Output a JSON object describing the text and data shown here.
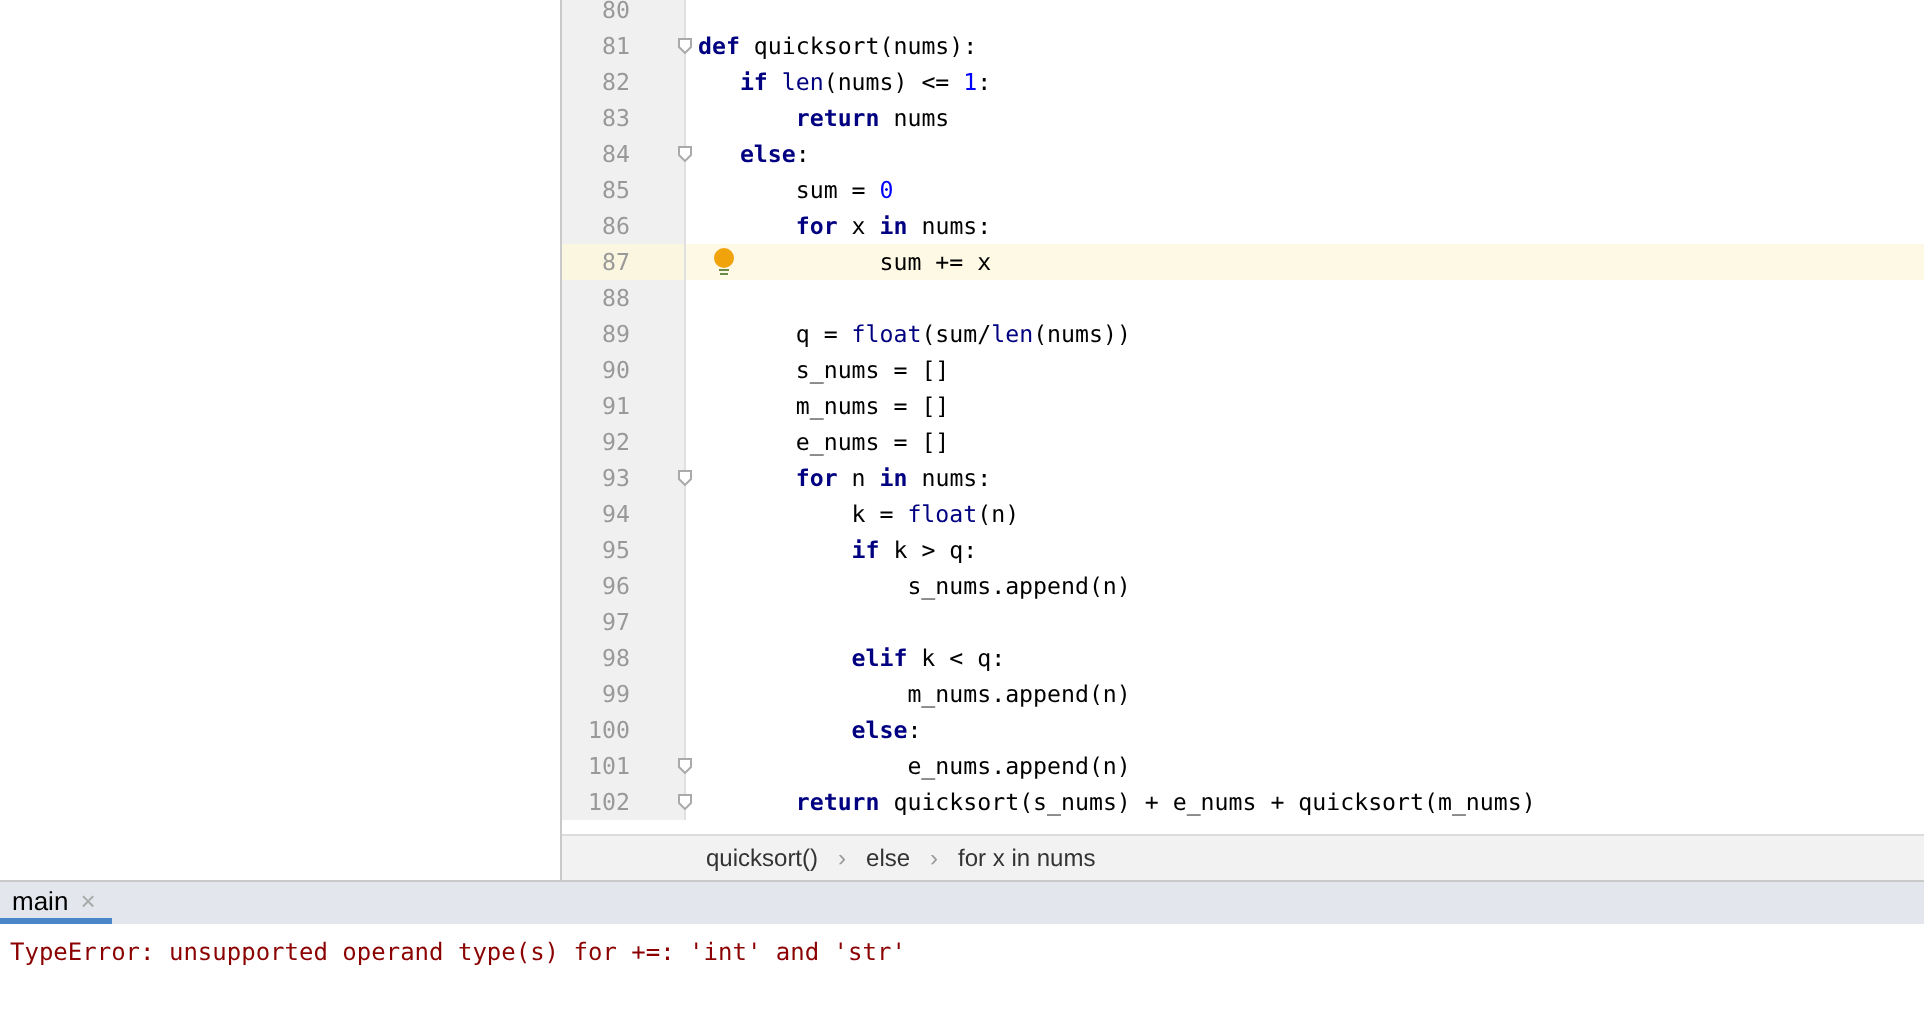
{
  "editor": {
    "lines": [
      {
        "number": "80"
      },
      {
        "number": "81",
        "tokens": [
          {
            "text": "def",
            "kind": "keyword"
          },
          {
            "text": " quicksort(nums):",
            "kind": "plain"
          }
        ],
        "fold": true
      },
      {
        "number": "82",
        "tokens": [
          {
            "text": "   if",
            "kind": "keyword"
          },
          {
            "text": " len",
            "kind": "builtin"
          },
          {
            "text": "(nums) <= ",
            "kind": "plain"
          },
          {
            "text": "1",
            "kind": "number"
          },
          {
            "text": ":",
            "kind": "plain"
          }
        ]
      },
      {
        "number": "83",
        "tokens": [
          {
            "text": "       return",
            "kind": "keyword"
          },
          {
            "text": " nums",
            "kind": "plain"
          }
        ]
      },
      {
        "number": "84",
        "tokens": [
          {
            "text": "   else",
            "kind": "keyword"
          },
          {
            "text": ":",
            "kind": "plain"
          }
        ],
        "fold": true
      },
      {
        "number": "85",
        "tokens": [
          {
            "text": "       sum = ",
            "kind": "plain"
          },
          {
            "text": "0",
            "kind": "number"
          }
        ]
      },
      {
        "number": "86",
        "tokens": [
          {
            "text": "       for",
            "kind": "keyword"
          },
          {
            "text": " x ",
            "kind": "plain"
          },
          {
            "text": "in",
            "kind": "keyword"
          },
          {
            "text": " nums:",
            "kind": "plain"
          }
        ]
      },
      {
        "number": "87",
        "tokens": [
          {
            "text": "             sum += x",
            "kind": "plain"
          }
        ],
        "highlighted": true,
        "bulb": true
      },
      {
        "number": "88"
      },
      {
        "number": "89",
        "tokens": [
          {
            "text": "       q = ",
            "kind": "plain"
          },
          {
            "text": "float",
            "kind": "builtin"
          },
          {
            "text": "(sum/",
            "kind": "plain"
          },
          {
            "text": "len",
            "kind": "builtin"
          },
          {
            "text": "(nums))",
            "kind": "plain"
          }
        ]
      },
      {
        "number": "90",
        "tokens": [
          {
            "text": "       s_nums = []",
            "kind": "plain"
          }
        ]
      },
      {
        "number": "91",
        "tokens": [
          {
            "text": "       m_nums = []",
            "kind": "plain"
          }
        ]
      },
      {
        "number": "92",
        "tokens": [
          {
            "text": "       e_nums = []",
            "kind": "plain"
          }
        ]
      },
      {
        "number": "93",
        "tokens": [
          {
            "text": "       for",
            "kind": "keyword"
          },
          {
            "text": " n ",
            "kind": "plain"
          },
          {
            "text": "in",
            "kind": "keyword"
          },
          {
            "text": " nums:",
            "kind": "plain"
          }
        ],
        "fold": true
      },
      {
        "number": "94",
        "tokens": [
          {
            "text": "           k = ",
            "kind": "plain"
          },
          {
            "text": "float",
            "kind": "builtin"
          },
          {
            "text": "(n)",
            "kind": "plain"
          }
        ]
      },
      {
        "number": "95",
        "tokens": [
          {
            "text": "           if",
            "kind": "keyword"
          },
          {
            "text": " k > q:",
            "kind": "plain"
          }
        ]
      },
      {
        "number": "96",
        "tokens": [
          {
            "text": "               s_nums.append(n)",
            "kind": "plain"
          }
        ]
      },
      {
        "number": "97"
      },
      {
        "number": "98",
        "tokens": [
          {
            "text": "           elif",
            "kind": "keyword"
          },
          {
            "text": " k < q:",
            "kind": "plain"
          }
        ]
      },
      {
        "number": "99",
        "tokens": [
          {
            "text": "               m_nums.append(n)",
            "kind": "plain"
          }
        ]
      },
      {
        "number": "100",
        "tokens": [
          {
            "text": "           else",
            "kind": "keyword"
          },
          {
            "text": ":",
            "kind": "plain"
          }
        ]
      },
      {
        "number": "101",
        "tokens": [
          {
            "text": "               e_nums.append(n)",
            "kind": "plain"
          }
        ],
        "fold": true
      },
      {
        "number": "102",
        "tokens": [
          {
            "text": "       return",
            "kind": "keyword"
          },
          {
            "text": " quicksort(s_nums) + e_nums + quicksort(m_nums)",
            "kind": "plain"
          }
        ],
        "fold": true
      }
    ],
    "breadcrumbs": [
      "quicksort()",
      "else",
      "for x in nums"
    ],
    "breadcrumb_separator": "›"
  },
  "run_panel": {
    "tabs": [
      {
        "label": "main",
        "selected": true,
        "close": "×"
      }
    ],
    "console": [
      "TypeError: unsupported operand type(s) for +=: 'int' and 'str'"
    ]
  }
}
